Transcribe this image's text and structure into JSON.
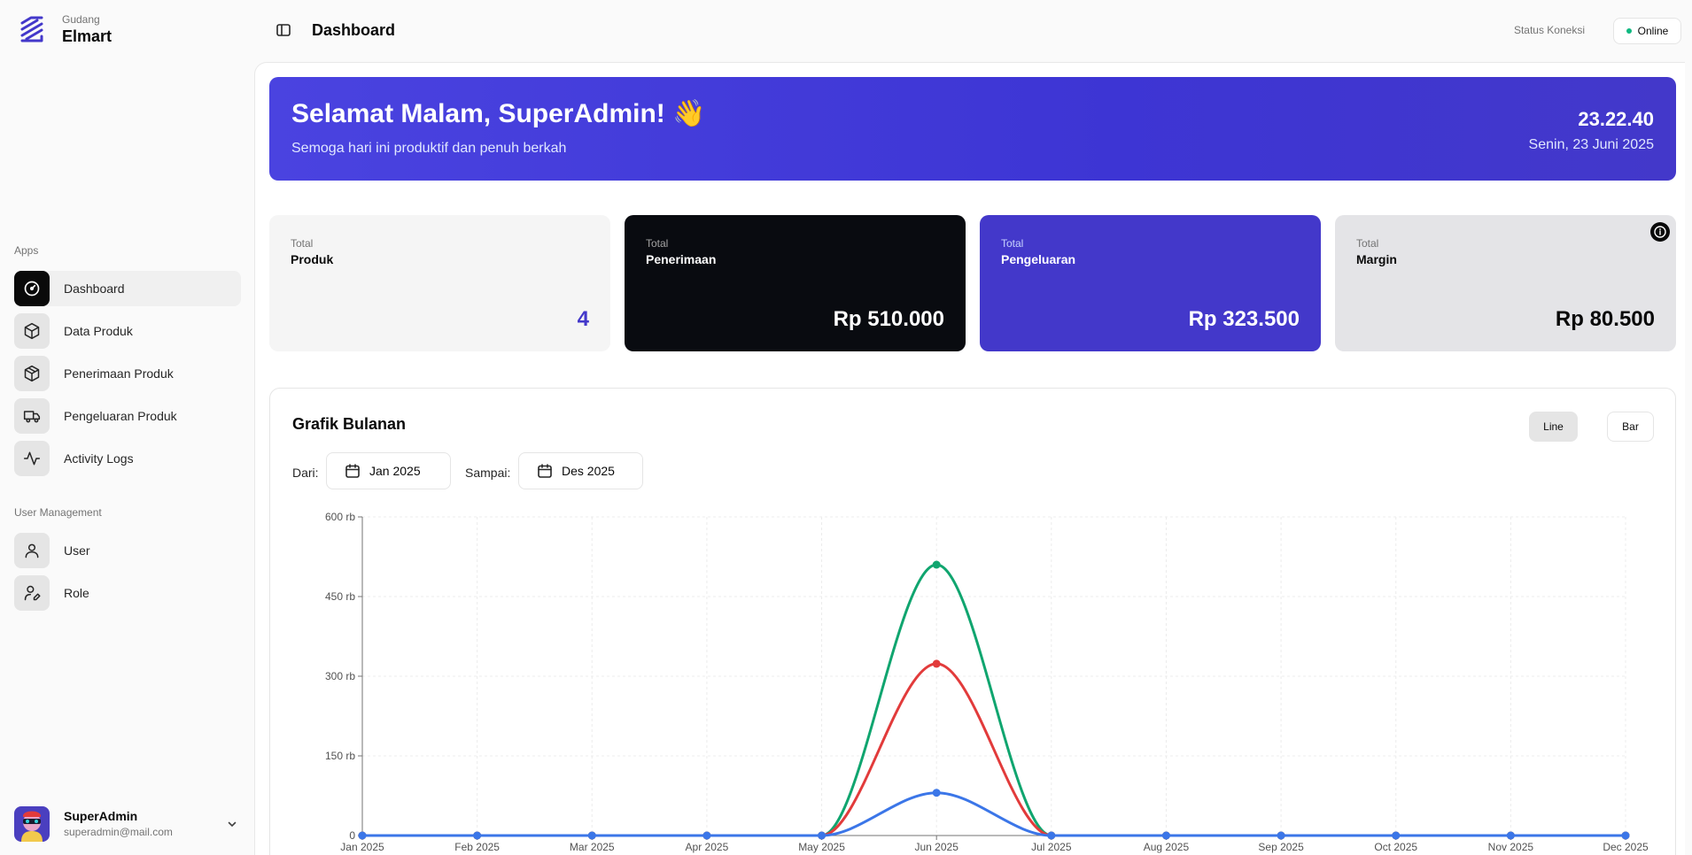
{
  "brand": {
    "sub": "Gudang",
    "name": "Elmart"
  },
  "sidebar": {
    "groups": [
      {
        "label": "Apps"
      },
      {
        "label": "User Management"
      }
    ],
    "items": [
      {
        "label": "Dashboard",
        "icon": "gauge-icon"
      },
      {
        "label": "Data Produk",
        "icon": "box-icon"
      },
      {
        "label": "Penerimaan Produk",
        "icon": "package-in-icon"
      },
      {
        "label": "Pengeluaran Produk",
        "icon": "truck-icon"
      },
      {
        "label": "Activity Logs",
        "icon": "activity-icon"
      },
      {
        "label": "User",
        "icon": "user-icon"
      },
      {
        "label": "Role",
        "icon": "user-pen-icon"
      }
    ]
  },
  "user": {
    "name": "SuperAdmin",
    "email": "superadmin@mail.com"
  },
  "header": {
    "title": "Dashboard",
    "status_label": "Status Koneksi",
    "status_value": "Online"
  },
  "hero": {
    "title": "Selamat Malam, SuperAdmin! 👋",
    "subtitle": "Semoga hari ini produktif dan penuh berkah",
    "time": "23.22.40",
    "date": "Senin, 23 Juni 2025"
  },
  "stats": [
    {
      "top": "Total",
      "title": "Produk",
      "value": "4"
    },
    {
      "top": "Total",
      "title": "Penerimaan",
      "value": "Rp 510.000"
    },
    {
      "top": "Total",
      "title": "Pengeluaran",
      "value": "Rp 323.500"
    },
    {
      "top": "Total",
      "title": "Margin",
      "value": "Rp 80.500"
    }
  ],
  "chart_section": {
    "title": "Grafik Bulanan",
    "toggle_line": "Line",
    "toggle_bar": "Bar",
    "from_label": "Dari:",
    "from_value": "Jan 2025",
    "to_label": "Sampai:",
    "to_value": "Des 2025"
  },
  "colors": {
    "accent": "#4338ca",
    "dark_card": "#090b10",
    "purple_card": "#4338ca",
    "gray_card": "#e4e4e7",
    "green_series": "#10a56f",
    "red_series": "#e23b3b",
    "blue_series": "#3b76e8"
  },
  "chart_data": {
    "type": "line",
    "x": [
      "Jan 2025",
      "Feb 2025",
      "Mar 2025",
      "Apr 2025",
      "May 2025",
      "Jun 2025",
      "Jul 2025",
      "Aug 2025",
      "Sep 2025",
      "Oct 2025",
      "Nov 2025",
      "Dec 2025"
    ],
    "ylim": [
      0,
      600000
    ],
    "yticks": [
      0,
      150000,
      300000,
      450000,
      600000
    ],
    "ytick_labels": [
      "0",
      "150 rb",
      "300 rb",
      "450 rb",
      "600 rb"
    ],
    "grid": true,
    "series": [
      {
        "color": "#10a56f",
        "values": [
          0,
          0,
          0,
          0,
          0,
          510000,
          0,
          0,
          0,
          0,
          0,
          0
        ]
      },
      {
        "color": "#e23b3b",
        "values": [
          0,
          0,
          0,
          0,
          0,
          323500,
          0,
          0,
          0,
          0,
          0,
          0
        ]
      },
      {
        "color": "#3b76e8",
        "values": [
          0,
          0,
          0,
          0,
          0,
          80500,
          0,
          0,
          0,
          0,
          0,
          0
        ]
      }
    ]
  }
}
